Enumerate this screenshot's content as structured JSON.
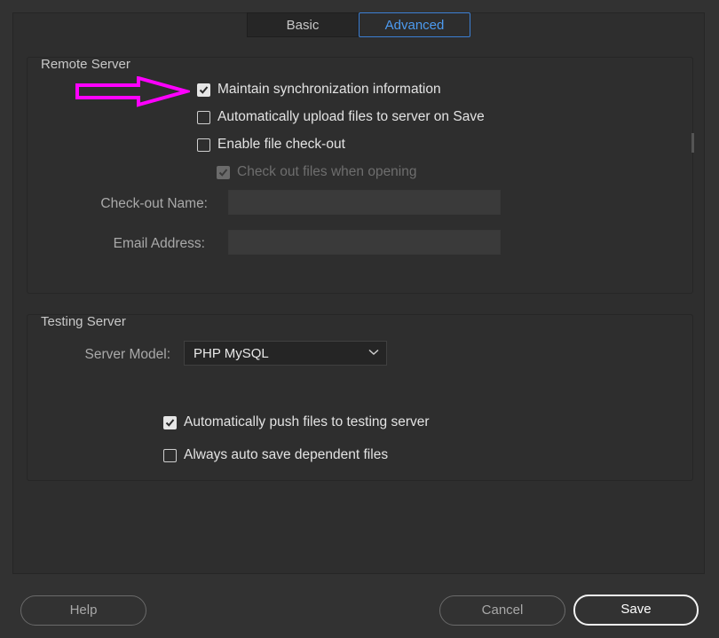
{
  "tabs": [
    {
      "label": "Basic",
      "active": false
    },
    {
      "label": "Advanced",
      "active": true
    }
  ],
  "remote_server": {
    "title": "Remote Server",
    "maintain_sync": {
      "label": "Maintain synchronization information",
      "checked": true
    },
    "auto_upload": {
      "label": "Automatically upload files to server on Save",
      "checked": false
    },
    "enable_checkout": {
      "label": "Enable file check-out",
      "checked": false
    },
    "checkout_on_open": {
      "label": "Check out files when opening",
      "checked": true,
      "disabled": true
    },
    "checkout_name": {
      "label": "Check-out Name:",
      "value": ""
    },
    "email_address": {
      "label": "Email Address:",
      "value": ""
    }
  },
  "testing_server": {
    "title": "Testing Server",
    "server_model": {
      "label": "Server Model:",
      "selected": "PHP MySQL"
    },
    "auto_push": {
      "label": "Automatically push files to testing server",
      "checked": true
    },
    "auto_save_dependent": {
      "label": "Always auto save dependent files",
      "checked": false
    }
  },
  "footer": {
    "help_label": "Help",
    "cancel_label": "Cancel",
    "save_label": "Save"
  },
  "annotation": {
    "icon": "arrow-right-icon",
    "color": "#ff00ff"
  },
  "colors": {
    "accent": "#3c7fd4",
    "background": "#323232"
  }
}
